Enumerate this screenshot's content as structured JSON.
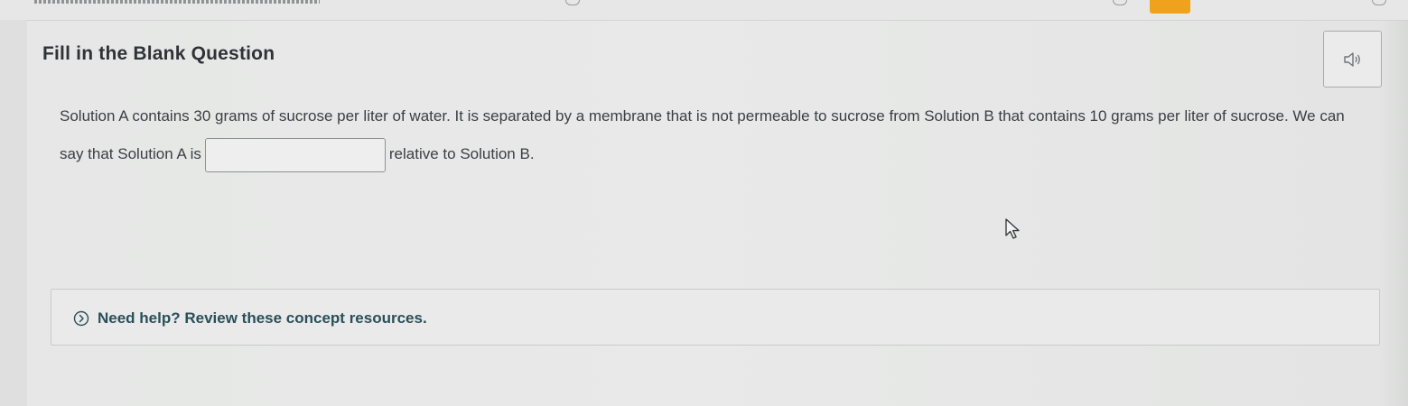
{
  "question": {
    "title": "Fill in the Blank Question",
    "text_before_blank": "Solution A contains 30 grams of sucrose per liter of water. It is separated by a membrane that is not permeable to sucrose from Solution B that contains 10 grams per liter of sucrose. We can say that Solution A is",
    "blank_value": "",
    "text_after_blank": "relative to Solution B."
  },
  "audio_button": {
    "icon": "speaker-icon"
  },
  "help": {
    "label": "Need help? Review these concept resources.",
    "icon": "chevron-circle-icon"
  },
  "colors": {
    "accent": "#f0a21d",
    "help_text": "#2b4f5a",
    "body_text": "#3b3f43"
  }
}
